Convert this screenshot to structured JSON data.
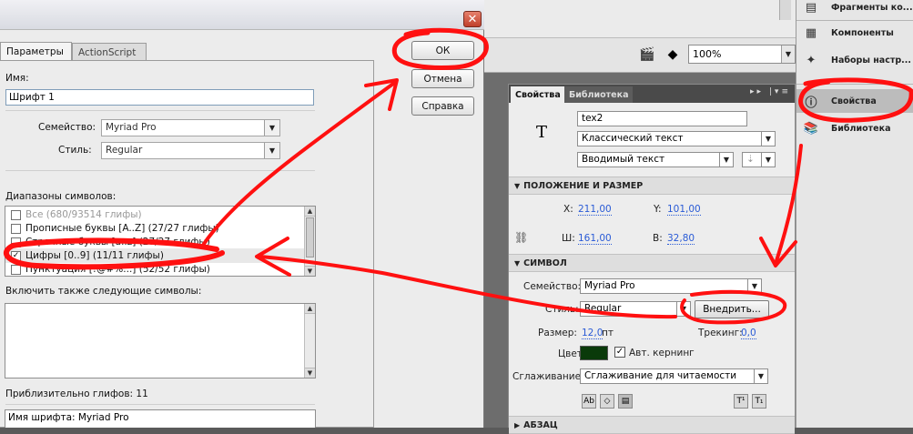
{
  "dialog": {
    "tabs": [
      "Параметры",
      "ActionScript"
    ],
    "name_label": "Имя:",
    "name_value": "Шрифт 1",
    "family_label": "Семейство:",
    "family_value": "Myriad Pro",
    "style_label": "Стиль:",
    "style_value": "Regular",
    "ranges_label": "Диапазоны символов:",
    "ranges": [
      {
        "label": "Все  (680/93514 глифы)",
        "checked": false,
        "state": "disabled"
      },
      {
        "label": "Прописные буквы [A..Z]  (27/27 глифы)",
        "checked": false,
        "state": "normal"
      },
      {
        "label": "Строчные буквы [a..z]  (27/27 глифы)",
        "checked": false,
        "state": "normal"
      },
      {
        "label": "Цифры [0..9]  (11/11 глифы)",
        "checked": true,
        "state": "selected"
      },
      {
        "label": "Пунктуация [!@#%...]  (52/52 глифы)",
        "checked": false,
        "state": "normal"
      }
    ],
    "extra_label": "Включить также следующие символы:",
    "glyph_count_label": "Приблизительно глифов: 11",
    "info_line": "Имя шрифта: Myriad Pro",
    "buttons": {
      "ok": "ОК",
      "cancel": "Отмена",
      "help": "Справка"
    },
    "close_glyph": "✕"
  },
  "toolbar": {
    "zoom_value": "100%"
  },
  "right_panel": {
    "items": [
      {
        "label": "Фрагменты ко...",
        "icon": "code-snippets-icon"
      },
      {
        "label": "Компоненты",
        "icon": "components-icon"
      },
      {
        "label": "Наборы настр...",
        "icon": "presets-icon"
      },
      {
        "label": "Свойства",
        "icon": "properties-icon"
      },
      {
        "label": "Библиотека",
        "icon": "library-icon"
      }
    ]
  },
  "properties": {
    "tabs": [
      "Свойства",
      "Библиотека"
    ],
    "menu_glyphs": "▸▸ |▾≡",
    "instance_name": "tex2",
    "text_engine": "Классический текст",
    "text_type": "Вводимый текст",
    "position_section": "ПОЛОЖЕНИЕ И РАЗМЕР",
    "x_label": "X:",
    "x_value": "211,00",
    "y_label": "Y:",
    "y_value": "101,00",
    "w_label": "Ш:",
    "w_value": "161,00",
    "h_label": "В:",
    "h_value": "32,80",
    "symbol_section": "СИМВОЛ",
    "family_label": "Семейство:",
    "family_value": "Myriad Pro",
    "style_label": "Стиль:",
    "style_value": "Regular",
    "embed_button": "Внедрить...",
    "size_label": "Размер:",
    "size_value": "12,0",
    "size_unit": "пт",
    "tracking_label": "Трекинг:",
    "tracking_value": "0,0",
    "color_label": "Цвет:",
    "color_hex": "#0a3a0a",
    "autokern_label": "Авт. кернинг",
    "antialias_label": "Сглаживание:",
    "antialias_value": "Сглаживание для читаемости",
    "paragraph_section": "АБЗАЦ"
  },
  "colors": {
    "annotation_red": "#ff1010"
  }
}
